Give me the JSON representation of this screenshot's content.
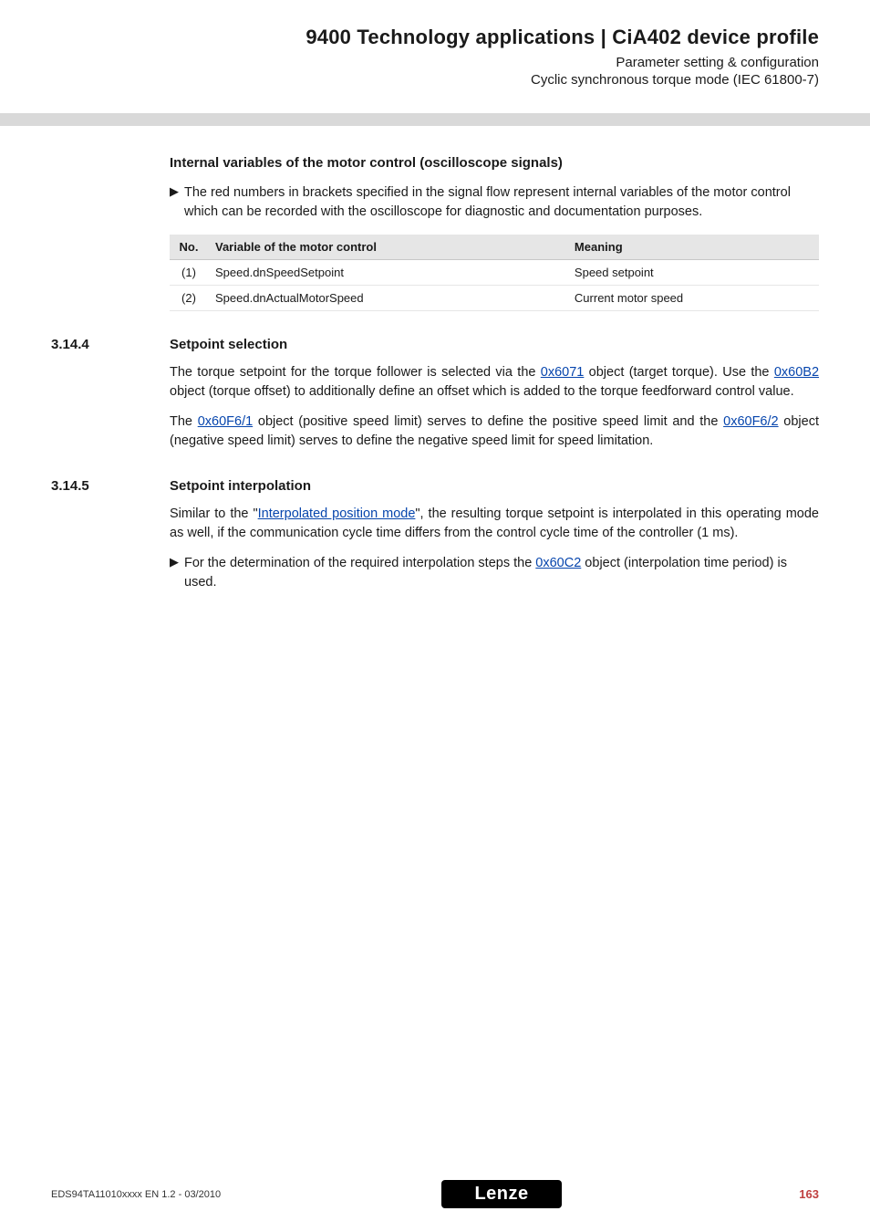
{
  "header": {
    "title": "9400 Technology applications | CiA402 device profile",
    "sub1": "Parameter setting & configuration",
    "sub2": "Cyclic synchronous torque mode (IEC 61800-7)"
  },
  "sec_intvars": {
    "heading": "Internal variables of the motor control (oscilloscope signals)",
    "bullet": "The red numbers in brackets specified in the signal flow represent internal variables of the motor control which can be recorded with the oscilloscope for diagnostic and documentation purposes.",
    "table": {
      "col_no": "No.",
      "col_var": "Variable of the motor control",
      "col_mean": "Meaning",
      "rows": [
        {
          "no": "(1)",
          "var": "Speed.dnSpeedSetpoint",
          "mean": "Speed setpoint"
        },
        {
          "no": "(2)",
          "var": "Speed.dnActualMotorSpeed",
          "mean": "Current motor speed"
        }
      ]
    }
  },
  "sec_3_14_4": {
    "num": "3.14.4",
    "title": "Setpoint selection",
    "p1_a": "The torque setpoint for the torque follower is selected via the ",
    "p1_link1": "0x6071",
    "p1_b": " object (target torque). Use the ",
    "p1_link2": "0x60B2",
    "p1_c": " object (torque offset) to additionally define an offset which is added to the torque feedforward control value.",
    "p2_a": "The ",
    "p2_link1": "0x60F6/1",
    "p2_b": " object (positive speed limit) serves to define the positive speed limit and the ",
    "p2_link2": "0x60F6/2",
    "p2_c": " object (negative speed limit) serves to define the negative speed limit for speed limitation."
  },
  "sec_3_14_5": {
    "num": "3.14.5",
    "title": "Setpoint interpolation",
    "p1_a": "Similar to the \"",
    "p1_link1": "Interpolated position mode",
    "p1_b": "\", the resulting torque setpoint is interpolated in this operating mode as well, if the communication cycle time differs from the control cycle time of the controller (1 ms).",
    "bullet_a": "For the determination of the required interpolation steps the ",
    "bullet_link": "0x60C2",
    "bullet_b": " object (interpolation time period) is used."
  },
  "footer": {
    "left": "EDS94TA11010xxxx EN 1.2 - 03/2010",
    "logo": "Lenze",
    "page": "163"
  },
  "glyphs": {
    "triangle": "▶"
  }
}
